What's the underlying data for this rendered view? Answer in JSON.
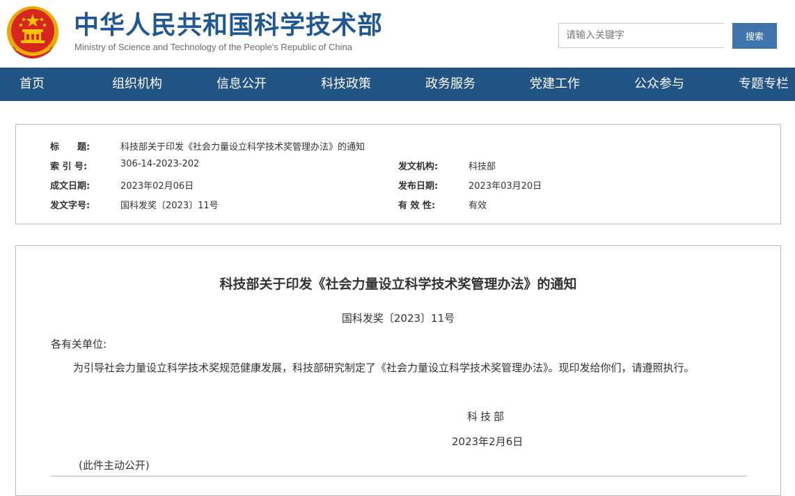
{
  "header": {
    "title": "中华人民共和国科学技术部",
    "subtitle": "Ministry of Science and Technology of the People's Republic of China"
  },
  "search": {
    "placeholder": "请输入关键字",
    "value": "",
    "button_label": "搜索"
  },
  "nav": {
    "items": [
      "首页",
      "组织机构",
      "信息公开",
      "科技政策",
      "政务服务",
      "党建工作",
      "公众参与",
      "专题专栏"
    ]
  },
  "meta": {
    "title_label": "标　　题:",
    "title_value": "科技部关于印发《社会力量设立科学技术奖管理办法》的通知",
    "index_label": "索 引 号:",
    "index_value": "306-14-2023-202",
    "issuer_label": "发文机构:",
    "issuer_value": "科技部",
    "written_date_label": "成文日期:",
    "written_date_value": "2023年02月06日",
    "publish_date_label": "发布日期:",
    "publish_date_value": "2023年03月20日",
    "doc_number_label": "发文字号:",
    "doc_number_value": "国科发奖〔2023〕11号",
    "validity_label": "有 效 性:",
    "validity_value": "有效"
  },
  "document": {
    "title": "科技部关于印发《社会力量设立科学技术奖管理办法》的通知",
    "number": "国科发奖〔2023〕11号",
    "addressee": "各有关单位:",
    "paragraph": "为引导社会力量设立科学技术奖规范健康发展，科技部研究制定了《社会力量设立科学技术奖管理办法》。现印发给你们，请遵照执行。",
    "signature": "科技部",
    "date": "2023年2月6日",
    "public_note": "(此件主动公开)"
  },
  "colors": {
    "brand_blue": "#1f5794",
    "nav_bg": "#225385",
    "emblem_red": "#d7261e",
    "emblem_gold": "#f5c400"
  }
}
